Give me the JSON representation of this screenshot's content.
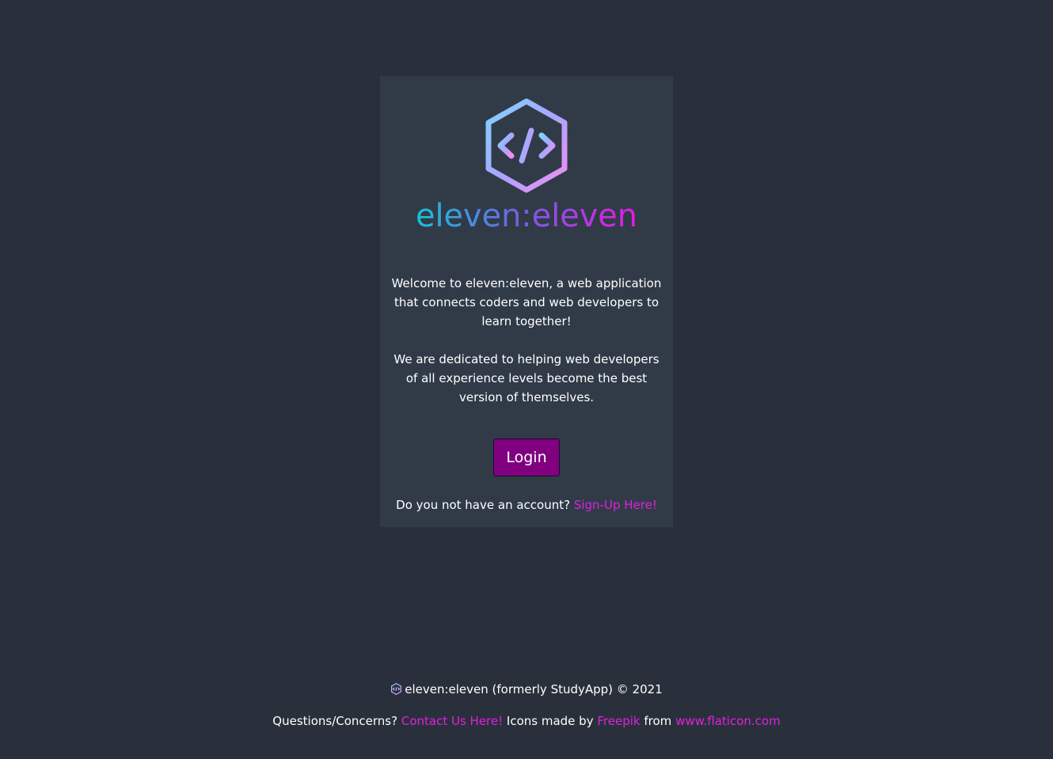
{
  "brand": {
    "logo_icon": "code-hexagon-icon",
    "wordmark": "eleven:eleven",
    "gradient_start": "#14c4d8",
    "gradient_end": "#e618e6"
  },
  "intro": {
    "paragraph1": "Welcome to eleven:eleven, a web application that connects coders and web developers to learn together!",
    "paragraph2": "We are dedicated to helping web developers of all experience levels become the best version of themselves."
  },
  "login": {
    "label": "Login",
    "color": "#800080"
  },
  "signup": {
    "prompt": "Do you not have an account?",
    "link": "Sign-Up Here!"
  },
  "footer": {
    "icon": "code-hexagon-icon",
    "copyright": "eleven:eleven (formerly StudyApp) © 2021",
    "questions": "Questions/Concerns?",
    "contact_link": "Contact Us Here!",
    "icons_made_by": "Icons made by",
    "freepik_link": "Freepik",
    "from": "from",
    "flaticon_link": "www.flaticon.com"
  },
  "colors": {
    "page_bg": "#2a303b",
    "card_bg": "#313b48",
    "link": "#e020e0"
  }
}
